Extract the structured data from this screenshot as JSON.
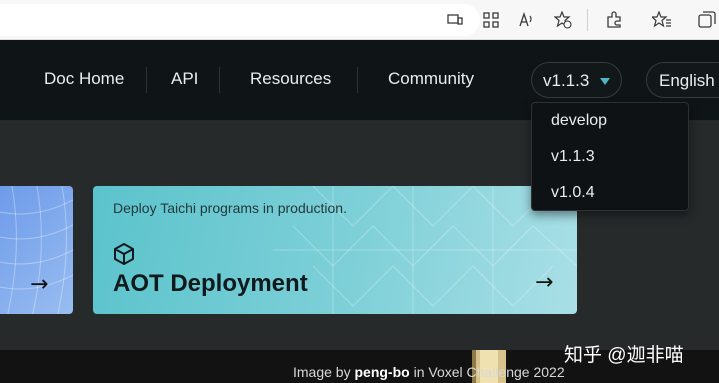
{
  "browser": {
    "icons": [
      "screen-cast-icon",
      "grid-icon",
      "read-aloud-icon",
      "add-favorite-icon",
      "extensions-icon",
      "favorites-icon",
      "collections-icon"
    ]
  },
  "nav": {
    "links": [
      "Doc Home",
      "API",
      "Resources",
      "Community"
    ],
    "version_current": "v1.1.3",
    "language": "English",
    "accent_color": "#4cb5c6"
  },
  "dropdown": {
    "options": [
      "develop",
      "v1.1.3",
      "v1.0.4"
    ]
  },
  "card": {
    "description": "Deploy Taichi programs in production.",
    "title": "AOT Deployment",
    "icon": "cube-icon"
  },
  "footer": {
    "credit_prefix": "Image by ",
    "credit_author": "peng-bo",
    "credit_suffix": " in Voxel Challenge 2022"
  },
  "watermark": "知乎 @迦非喵"
}
